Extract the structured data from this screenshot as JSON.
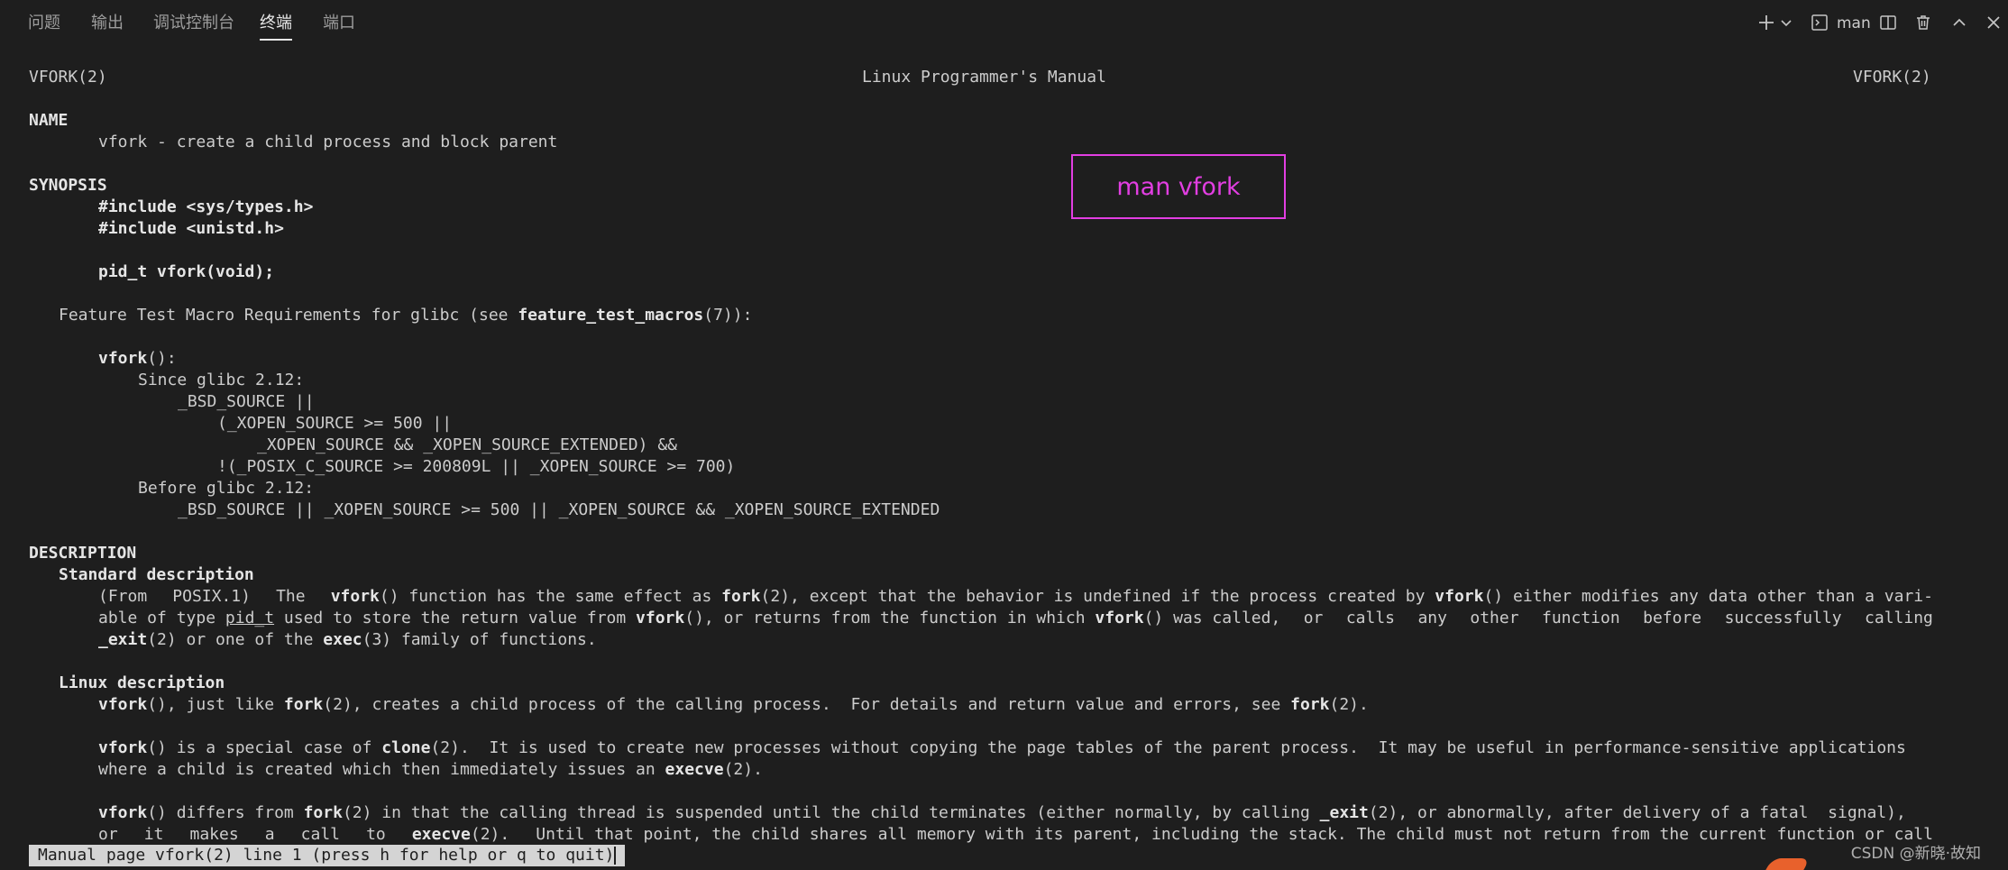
{
  "panel": {
    "tabs": [
      {
        "label": "问题"
      },
      {
        "label": "输出"
      },
      {
        "label": "调试控制台"
      },
      {
        "label": "终端"
      },
      {
        "label": "端口"
      }
    ],
    "active_tab": "终端",
    "terminal_name": "man",
    "icons": [
      "plus-icon",
      "chevron-down-icon",
      "terminal-icon",
      "split-icon",
      "trash-icon",
      "chevron-up-icon",
      "close-icon"
    ]
  },
  "man": {
    "header_left": "VFORK(2)",
    "header_center": "Linux Programmer's Manual",
    "header_right": "VFORK(2)",
    "name_heading": "NAME",
    "name_text": "vfork - create a child process and block parent",
    "synopsis_heading": "SYNOPSIS",
    "include1": "#include <sys/types.h>",
    "include2": "#include <unistd.h>",
    "prototype": "pid_t vfork(void);",
    "ftm_prefix": "Feature Test Macro Requirements for glibc (see ",
    "ftm_link": "feature_test_macros",
    "ftm_suffix": "(7)):",
    "ftm_func": "vfork",
    "ftm_func_suffix": "():",
    "since": "Since glibc 2.12:",
    "since_l1": "_BSD_SOURCE ||",
    "since_l2": "(_XOPEN_SOURCE >= 500 ||",
    "since_l3": "_XOPEN_SOURCE && _XOPEN_SOURCE_EXTENDED) &&",
    "since_l4": "!(_POSIX_C_SOURCE >= 200809L || _XOPEN_SOURCE >= 700)",
    "before": "Before glibc 2.12:",
    "before_l1": "_BSD_SOURCE || _XOPEN_SOURCE >= 500 || _XOPEN_SOURCE && _XOPEN_SOURCE_EXTENDED",
    "description_heading": "DESCRIPTION",
    "std_heading": "Standard description",
    "std_p1_words": [
      "(From",
      "POSIX.1)",
      "The",
      "vfork() function has the same effect as fork(2), except that the behavior is undefined if the process created by vfork() either modifies any data other than a vari-"
    ],
    "std_p2_words": [
      "able of type pid_t used to store the return value from vfork(), or returns from the function in which vfork() was called,",
      "or",
      "calls",
      "any",
      "other",
      "function",
      "before",
      "successfully",
      "calling"
    ],
    "std_p3": "_exit(2) or one of the exec(3) family of functions.",
    "linux_heading": "Linux description",
    "linux_p1": "vfork(), just like fork(2), creates a child process of the calling process.  For details and return value and errors, see fork(2).",
    "linux_p2a": "vfork() is a special case of clone(2).  It is used to create new processes without copying the page tables of the parent process.  It may be useful in performance-sensitive applications",
    "linux_p2b": "where a child is created which then immediately issues an execve(2).",
    "linux_p3a": "vfork() differs from fork(2) in that the calling thread is suspended until the child terminates (either normally, by calling _exit(2), or abnormally, after delivery of a fatal  signal),",
    "linux_p3b_words": [
      "or",
      "it",
      "makes",
      "a",
      "call",
      "to",
      "execve(2).",
      "Until that point, the child shares all memory with its parent, including the stack.  The child must not return from the current function or call"
    ]
  },
  "annotation": {
    "text": "man vfork",
    "color": "#e23ee2"
  },
  "status_line": "Manual page vfork(2) line 1 (press h for help or q to quit)",
  "watermark": "CSDN @新晓·故知"
}
